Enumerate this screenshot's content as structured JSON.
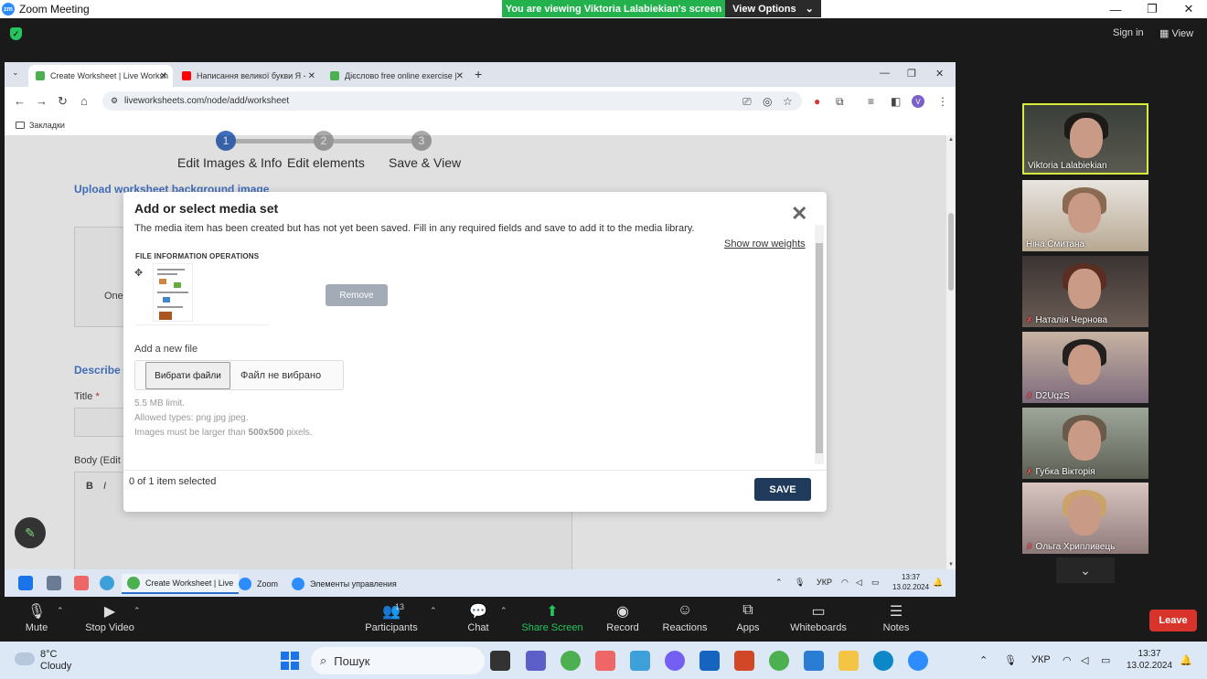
{
  "zoom": {
    "window_title": "Zoom Meeting",
    "viewing_banner": "You are viewing Viktoria Lalabiekian's screen",
    "view_options_label": "View Options",
    "sign_in": "Sign in",
    "view_label": "View",
    "toolbar": {
      "mute": "Mute",
      "stop_video": "Stop Video",
      "participants": "Participants",
      "participants_count": "13",
      "chat": "Chat",
      "share_screen": "Share Screen",
      "record": "Record",
      "reactions": "Reactions",
      "apps": "Apps",
      "whiteboards": "Whiteboards",
      "notes": "Notes",
      "leave": "Leave"
    },
    "participants": [
      {
        "name": "Viktoria Lalabiekian",
        "muted": false
      },
      {
        "name": "Ніна Смитана",
        "muted": false
      },
      {
        "name": "Наталія Чернова",
        "muted": true
      },
      {
        "name": "D2UqzS",
        "muted": true
      },
      {
        "name": "Губка Вікторія",
        "muted": true
      },
      {
        "name": "Ольга Хрипливець",
        "muted": true
      }
    ]
  },
  "browser": {
    "tabs": [
      {
        "title": "Create Worksheet | Live Worksh",
        "active": true,
        "favicon_color": "#4caf50"
      },
      {
        "title": "Написання великої букви Я - ",
        "active": false,
        "favicon_color": "#ff0000"
      },
      {
        "title": "Дієслово free online exercise | ",
        "active": false,
        "favicon_color": "#4caf50"
      }
    ],
    "url": "liveworksheets.com/node/add/worksheet",
    "bookmarks_label": "Закладки",
    "profile_initial": "V"
  },
  "page": {
    "steps": [
      {
        "num": "1",
        "label": "Edit Images & Info",
        "active": true
      },
      {
        "num": "2",
        "label": "Edit elements",
        "active": false
      },
      {
        "num": "3",
        "label": "Save & View",
        "active": false
      }
    ],
    "upload_label": "Upload worksheet background image",
    "one_text": "One",
    "describe_label": "Describe",
    "title_label": "Title",
    "required_mark": "*",
    "body_label": "Body (Edit",
    "bold_btn": "B",
    "italic_btn": "I"
  },
  "modal": {
    "title": "Add or select media set",
    "close_label": "✕",
    "message": "The media item has been created but has not yet been saved. Fill in any required fields and save to add it to the media library.",
    "show_row_weights": "Show row weights",
    "file_ops_header": "FILE INFORMATION OPERATIONS",
    "remove_label": "Remove",
    "add_new_file": "Add a new file",
    "choose_files": "Вибрати файли",
    "no_file": "Файл не вибрано",
    "hint_limit": "5.5 MB limit.",
    "hint_types": "Allowed types: png jpg jpeg.",
    "hint_size_prefix": "Images must be larger than ",
    "hint_size_value": "500x500",
    "hint_size_suffix": " pixels.",
    "selected_text": "0 of 1 item selected",
    "save_label": "SAVE"
  },
  "inner_taskbar": {
    "items": [
      {
        "label": "Create Worksheet | Live",
        "color": "#4caf50",
        "active": true
      },
      {
        "label": "Zoom",
        "color": "#2d8cff",
        "active": false
      },
      {
        "label": "Элементы управления",
        "color": "#2d8cff",
        "active": false
      }
    ],
    "lang": "УКР",
    "time": "13:37",
    "date": "13.02.2024"
  },
  "windows_taskbar": {
    "temperature": "8°C",
    "weather": "Cloudy",
    "search_placeholder": "Пошук",
    "lang": "УКР",
    "time": "13:37",
    "date": "13.02.2024"
  }
}
